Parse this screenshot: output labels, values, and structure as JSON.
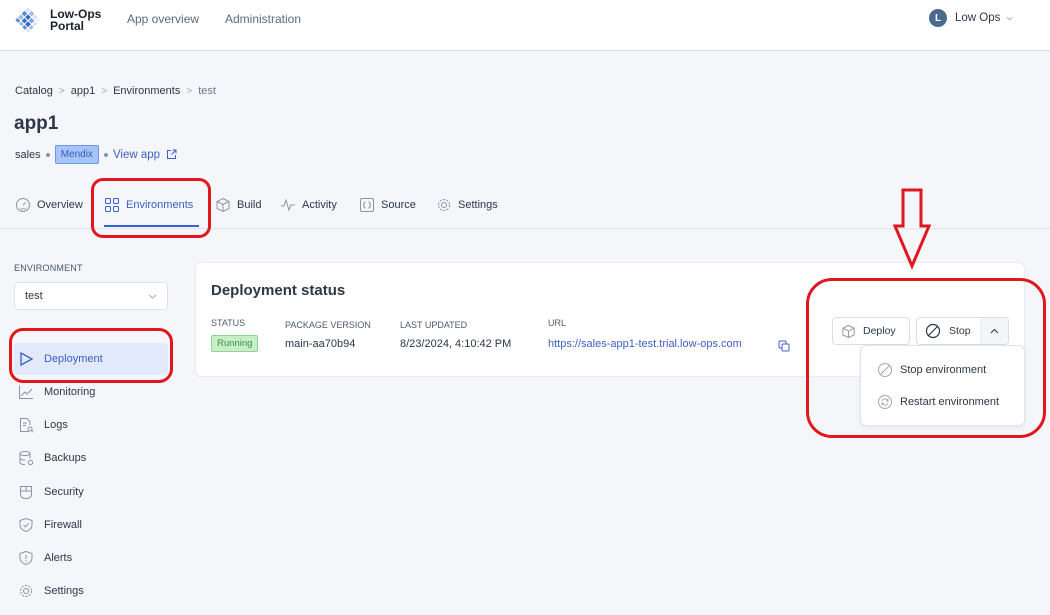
{
  "header": {
    "logo_line1": "Low-Ops",
    "logo_line2": "Portal",
    "nav": [
      {
        "label": "App overview"
      },
      {
        "label": "Administration"
      }
    ],
    "user": {
      "initial": "L",
      "name": "Low Ops"
    }
  },
  "breadcrumb": [
    {
      "label": "Catalog"
    },
    {
      "label": "app1"
    },
    {
      "label": "Environments"
    },
    {
      "label": "test"
    }
  ],
  "breadcrumb_separator": ">",
  "page": {
    "title": "app1",
    "team": "sales",
    "badge": "Mendix",
    "view_app_label": "View app"
  },
  "tabs": [
    {
      "label": "Overview",
      "icon": "gauge-icon"
    },
    {
      "label": "Environments",
      "icon": "grid-icon",
      "active": true
    },
    {
      "label": "Build",
      "icon": "package-icon"
    },
    {
      "label": "Activity",
      "icon": "activity-icon"
    },
    {
      "label": "Source",
      "icon": "code-braces-icon"
    },
    {
      "label": "Settings",
      "icon": "gear-icon"
    }
  ],
  "sidebar": {
    "environment_label": "ENVIRONMENT",
    "environment_value": "test",
    "items": [
      {
        "label": "Deployment",
        "icon": "play-icon",
        "active": true
      },
      {
        "label": "Monitoring",
        "icon": "chart-line-icon"
      },
      {
        "label": "Logs",
        "icon": "file-search-icon"
      },
      {
        "label": "Backups",
        "icon": "database-icon"
      },
      {
        "label": "Security",
        "icon": "mouse-icon"
      },
      {
        "label": "Firewall",
        "icon": "shield-check-icon"
      },
      {
        "label": "Alerts",
        "icon": "shield-alert-icon"
      },
      {
        "label": "Settings",
        "icon": "gear-icon"
      }
    ]
  },
  "deployment": {
    "title": "Deployment status",
    "fields": {
      "status_label": "STATUS",
      "status_value": "Running",
      "package_label": "PACKAGE VERSION",
      "package_value": "main-aa70b94",
      "updated_label": "LAST UPDATED",
      "updated_value": "8/23/2024, 4:10:42 PM",
      "url_label": "URL",
      "url_value": "https://sales-app1-test.trial.low-ops.com"
    },
    "actions": {
      "deploy_label": "Deploy",
      "stop_label": "Stop"
    },
    "menu": [
      {
        "label": "Stop environment",
        "icon": "stop-icon"
      },
      {
        "label": "Restart environment",
        "icon": "refresh-icon"
      }
    ]
  },
  "colors": {
    "accent": "#3163d6",
    "annotation": "#e0171d",
    "running": "#3d8d45"
  }
}
